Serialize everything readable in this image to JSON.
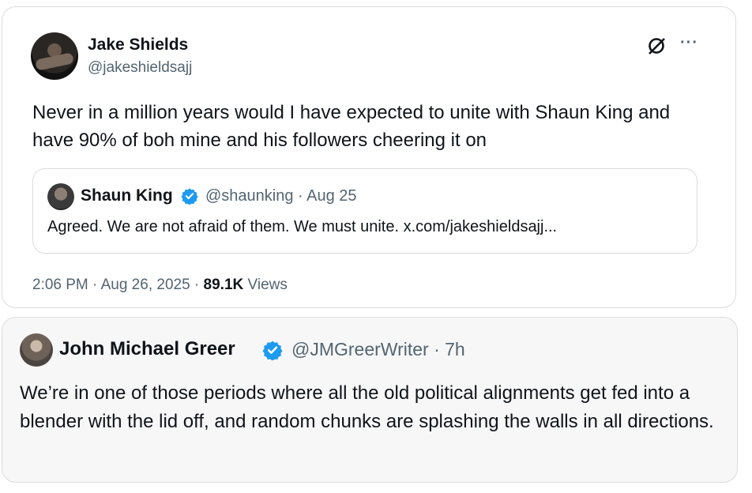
{
  "main_tweet": {
    "author_name": "Jake Shields",
    "author_handle": "@jakeshieldsajj",
    "text": "Never in a million years would I have expected to unite with Shaun King and have 90% of boh mine and his followers cheering it on",
    "quoted_tweet": {
      "author_name": "Shaun King",
      "meta": "@shaunking · Aug 25",
      "text": "Agreed. We are not afraid of them. We must unite. x.com/jakeshieldsajj..."
    },
    "timestamp": "2:06 PM · Aug 26, 2025 · ",
    "views_count": "89.1K",
    "views_label": " Views"
  },
  "reply_tweet": {
    "author_name": "John Michael Greer",
    "meta": "@JMGreerWriter · 7h",
    "text": "We’re in one of those periods where all the old political alignments get fed into a blender with the lid off, and random chunks are splashing the walls in all directions."
  },
  "icons": {
    "grok": "grok-icon",
    "more": "more-options-icon",
    "verified": "verified-badge-icon"
  },
  "colors": {
    "verified_blue": "#1d9bf0",
    "secondary_text": "#536471"
  }
}
